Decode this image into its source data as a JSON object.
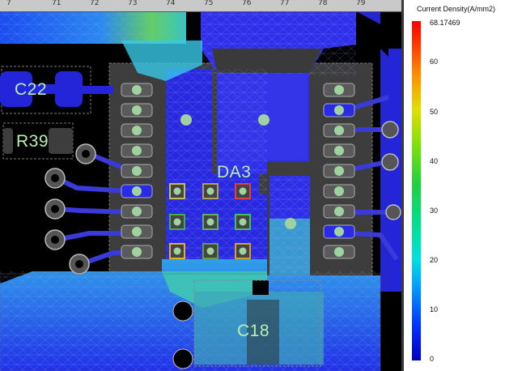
{
  "legend": {
    "title": "Current Density(A/mm2)",
    "max_label": "68.17469",
    "ticks": [
      "60",
      "50",
      "40",
      "30",
      "20",
      "10",
      "0"
    ]
  },
  "ruler": {
    "labels": [
      "7",
      "71",
      "72",
      "73",
      "74",
      "75",
      "76",
      "77",
      "78",
      "79"
    ]
  },
  "labels": {
    "c22": "C22",
    "r39": "R39",
    "da3": "DA3",
    "c18": "C18"
  },
  "colors": {
    "pad": "#4c4c4c",
    "copper_blue": "#2a2ae8",
    "via": "#9fd29f",
    "label": "#b8f0b0"
  },
  "scale": {
    "min": 0,
    "max": 68.17469
  }
}
